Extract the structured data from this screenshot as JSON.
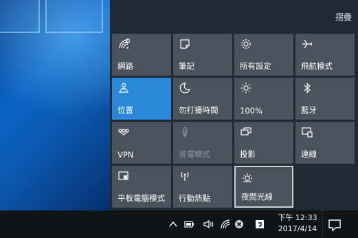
{
  "action_center": {
    "collapse_label": "摺疊",
    "tiles": [
      {
        "label": "網路",
        "icon": "network-wifi-icon",
        "state": "normal"
      },
      {
        "label": "筆記",
        "icon": "note-icon",
        "state": "normal"
      },
      {
        "label": "所有設定",
        "icon": "gear-icon",
        "state": "normal"
      },
      {
        "label": "飛航模式",
        "icon": "airplane-icon",
        "state": "normal"
      },
      {
        "label": "位置",
        "icon": "location-icon",
        "state": "active"
      },
      {
        "label": "勿打擾時間",
        "icon": "moon-icon",
        "state": "normal"
      },
      {
        "label": "100%",
        "icon": "brightness-icon",
        "state": "normal"
      },
      {
        "label": "藍牙",
        "icon": "bluetooth-icon",
        "state": "normal"
      },
      {
        "label": "VPN",
        "icon": "vpn-icon",
        "state": "normal"
      },
      {
        "label": "省電模式",
        "icon": "battery-saver-icon",
        "state": "disabled"
      },
      {
        "label": "投影",
        "icon": "project-icon",
        "state": "normal"
      },
      {
        "label": "連線",
        "icon": "connect-icon",
        "state": "normal"
      },
      {
        "label": "平板電腦模式",
        "icon": "tablet-mode-icon",
        "state": "normal"
      },
      {
        "label": "行動熱點",
        "icon": "hotspot-icon",
        "state": "normal"
      },
      {
        "label": "夜間光線",
        "icon": "night-light-icon",
        "state": "focused"
      }
    ]
  },
  "taskbar": {
    "clock": {
      "time": "下午 12:33",
      "date": "2017/4/14"
    },
    "tray_icons": [
      "chevron-up-icon",
      "battery-icon",
      "volume-icon",
      "wifi-icon",
      "error-badge-icon",
      "input-method-icon"
    ]
  },
  "colors": {
    "panel_bg": "#1f2a35",
    "tile_bg": "#4a535c",
    "accent": "#2b88d8",
    "taskbar_bg": "#101418"
  }
}
